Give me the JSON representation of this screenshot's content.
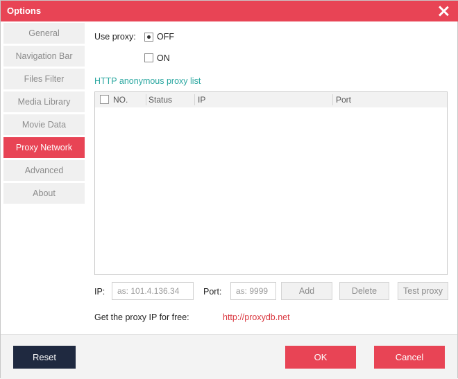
{
  "window": {
    "title": "Options"
  },
  "sidebar": {
    "items": [
      {
        "label": "General"
      },
      {
        "label": "Navigation Bar"
      },
      {
        "label": "Files Filter"
      },
      {
        "label": "Media Library"
      },
      {
        "label": "Movie Data"
      },
      {
        "label": "Proxy Network",
        "active": true
      },
      {
        "label": "Advanced"
      },
      {
        "label": "About"
      }
    ]
  },
  "proxy": {
    "use_proxy_label": "Use proxy:",
    "option_off": "OFF",
    "option_on": "ON",
    "selected": "OFF",
    "list_link": "HTTP anonymous proxy list",
    "table": {
      "columns": [
        "NO.",
        "Status",
        "IP",
        "Port"
      ],
      "rows": []
    },
    "ip_label": "IP:",
    "ip_placeholder": "as: 101.4.136.34",
    "port_label": "Port:",
    "port_placeholder": "as: 9999",
    "add_label": "Add",
    "delete_label": "Delete",
    "test_label": "Test proxy",
    "free_text": "Get the proxy IP for free:",
    "free_link": "http://proxydb.net"
  },
  "footer": {
    "reset_label": "Reset",
    "ok_label": "OK",
    "cancel_label": "Cancel"
  },
  "colors": {
    "accent": "#e84455",
    "dark_button": "#1f2940",
    "link_green": "#2aa7a0",
    "link_red": "#d9363e"
  },
  "icons": {
    "close": "close-icon"
  }
}
